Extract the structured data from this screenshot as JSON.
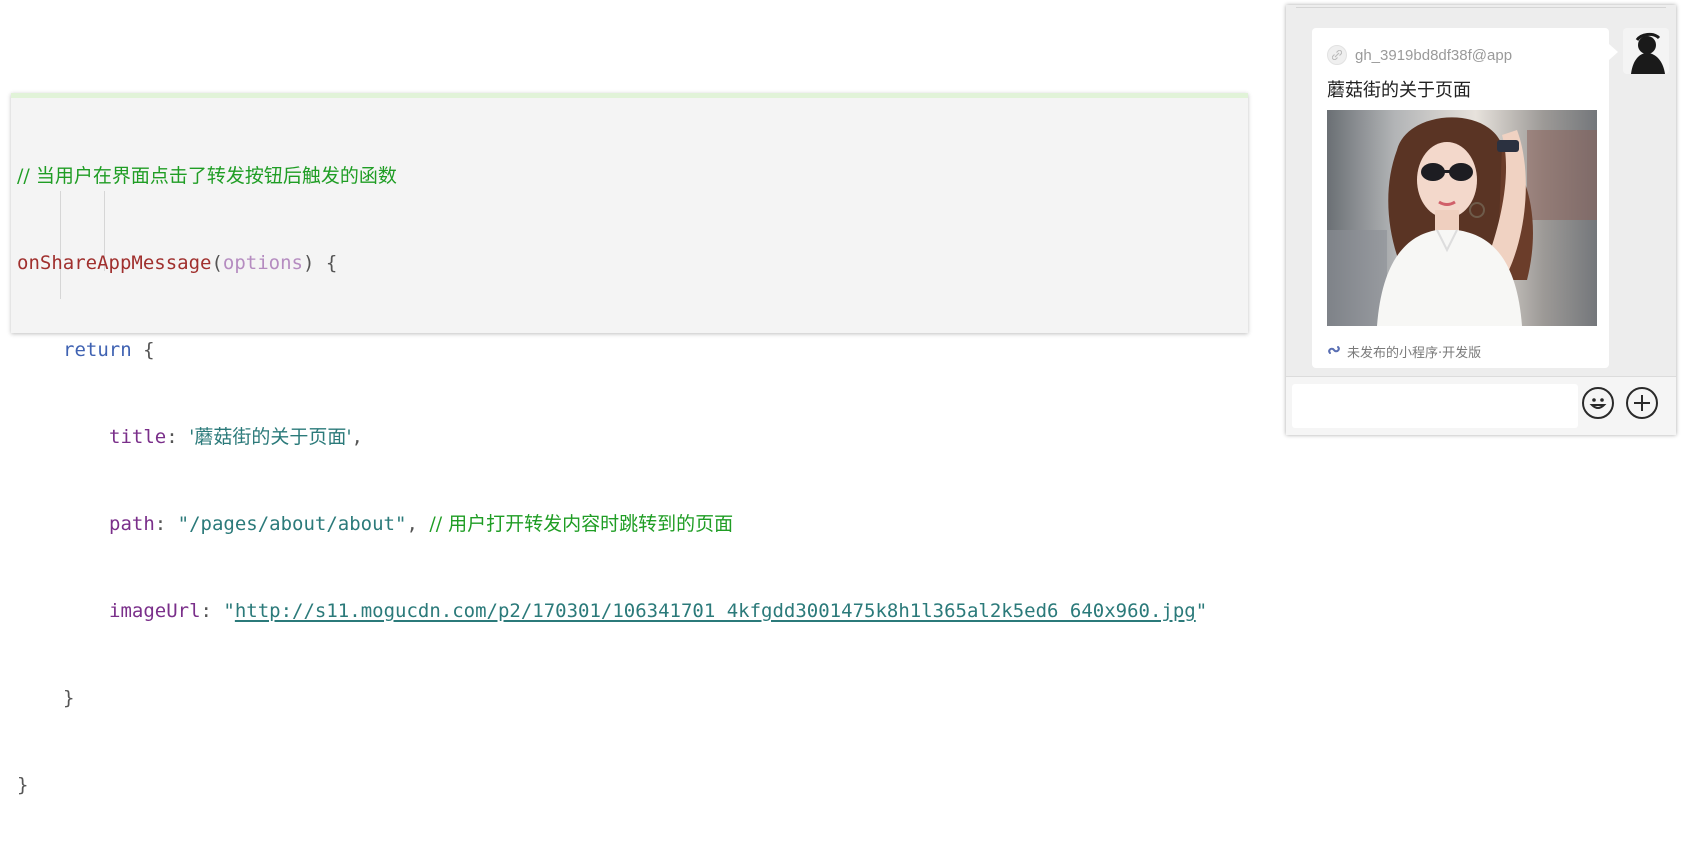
{
  "code": {
    "comment_1": "// 当用户在界面点击了转发按钮后触发的函数",
    "func_name": "onShareAppMessage",
    "paren_open": "(",
    "param": "options",
    "paren_close_brace": ") {",
    "kw_return": "return",
    "brace_open": " {",
    "prop_title": "title",
    "colon": ": ",
    "val_title": "'蘑菇街的关于页面'",
    "comma": ",",
    "prop_path": "path",
    "val_path": "\"/pages/about/about\"",
    "comment_2": "// 用户打开转发内容时跳转到的页面",
    "prop_imageUrl": "imageUrl",
    "quote": "\"",
    "val_image_url": "http://s11.mogucdn.com/p2/170301/106341701_4kfgdd3001475k8h1l365al2k5ed6_640x960.jpg",
    "brace_close_inner": "}",
    "brace_close_outer": "}"
  },
  "chat": {
    "app_id": "gh_3919bd8df38f@app",
    "share_title": "蘑菇街的关于页面",
    "footer": "未发布的小程序·开发版",
    "icons": {
      "app": "link-icon",
      "footer": "mini-program-icon",
      "emoji": "emoji-icon",
      "plus": "plus-icon"
    }
  },
  "colors": {
    "comment": "#1f9d24",
    "function": "#a0302e",
    "keyword": "#3f62b2",
    "property": "#7a2f8a",
    "string": "#2b7a7a"
  }
}
